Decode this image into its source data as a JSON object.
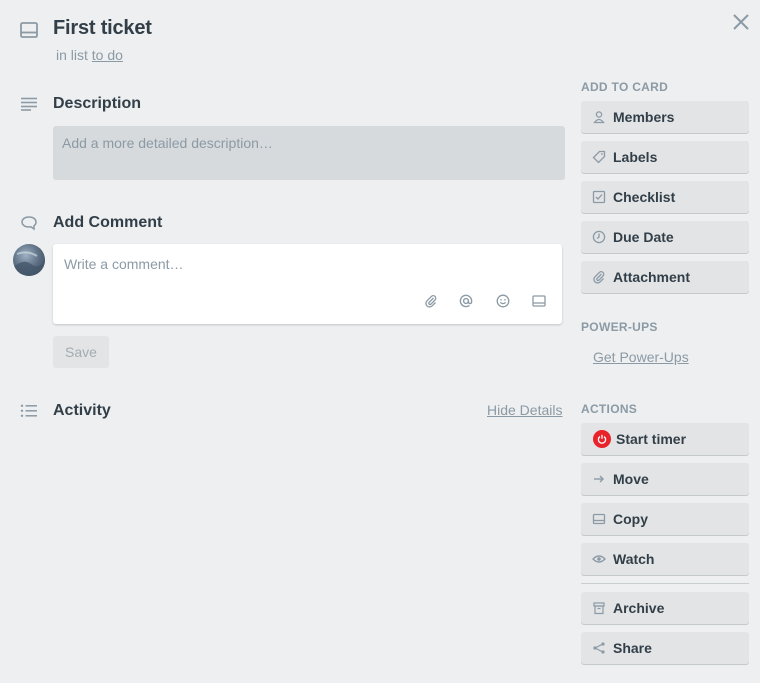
{
  "card": {
    "title": "First ticket",
    "in_list_prefix": "in list",
    "list_name": "to do"
  },
  "description": {
    "heading": "Description",
    "placeholder": "Add a more detailed description…"
  },
  "comment": {
    "heading": "Add Comment",
    "placeholder": "Write a comment…",
    "save_label": "Save",
    "tools": [
      "paperclip-icon",
      "at-icon",
      "emoji-icon",
      "card-icon"
    ]
  },
  "activity": {
    "heading": "Activity",
    "hide_details": "Hide Details"
  },
  "sidebar": {
    "add_to_card": {
      "heading": "ADD TO CARD",
      "items": [
        {
          "label": "Members",
          "icon": "person-icon"
        },
        {
          "label": "Labels",
          "icon": "tag-icon"
        },
        {
          "label": "Checklist",
          "icon": "checkbox-icon"
        },
        {
          "label": "Due Date",
          "icon": "clock-icon"
        },
        {
          "label": "Attachment",
          "icon": "paperclip-icon"
        }
      ]
    },
    "power_ups": {
      "heading": "POWER-UPS",
      "link": "Get Power-Ups"
    },
    "actions": {
      "heading": "ACTIONS",
      "items": [
        {
          "label": "Start timer",
          "icon": "power-icon",
          "accent": "#e8232a"
        },
        {
          "label": "Move",
          "icon": "arrow-right-icon"
        },
        {
          "label": "Copy",
          "icon": "card-icon"
        },
        {
          "label": "Watch",
          "icon": "eye-icon"
        },
        {
          "label": "Archive",
          "icon": "archive-icon"
        },
        {
          "label": "Share",
          "icon": "share-icon"
        }
      ]
    }
  },
  "colors": {
    "background": "#edeff0",
    "button": "#e2e4e6",
    "text_dark": "#333f48",
    "text_muted": "#8c9aa5"
  }
}
